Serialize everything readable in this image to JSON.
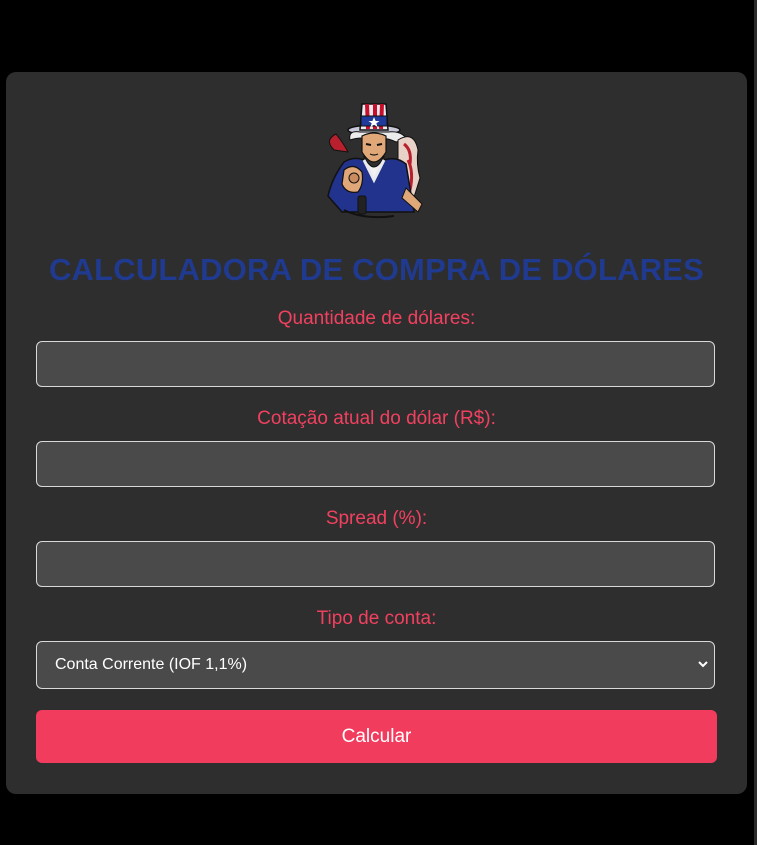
{
  "app": {
    "title": "CALCULADORA DE COMPRA DE DÓLARES",
    "logo_icon": "uncle-sam-icon"
  },
  "form": {
    "quantity_label": "Quantidade de dólares:",
    "quantity_value": "",
    "rate_label": "Cotação atual do dólar (R$):",
    "rate_value": "",
    "spread_label": "Spread (%):",
    "spread_value": "",
    "account_label": "Tipo de conta:",
    "account_selected": "Conta Corrente (IOF 1,1%)",
    "submit_label": "Calcular"
  },
  "colors": {
    "page_bg": "#000000",
    "card_bg": "#2e2e2e",
    "title": "#1f3a8f",
    "label": "#f2405f",
    "field_bg": "#4a4a4a",
    "button": "#f23c5e"
  }
}
